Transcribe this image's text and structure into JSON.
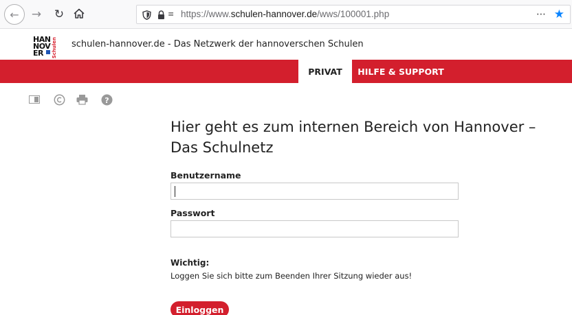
{
  "browser": {
    "url_prefix": "https://www.",
    "url_domain": "schulen-hannover.de",
    "url_path": "/wws/100001.php",
    "more_label": "⋯",
    "icons": [
      "back-arrow-icon",
      "forward-arrow-icon",
      "reload-icon",
      "home-icon",
      "shield-icon",
      "lock-icon",
      "permissions-icon",
      "more-icon",
      "star-icon"
    ],
    "accent_color": "#0a84ff"
  },
  "site": {
    "logo_lines": [
      "HAN",
      "NOV",
      "ER"
    ],
    "logo_sub": "Schulen",
    "tagline": "schulen-hannover.de - Das Netzwerk der hannoverschen Schulen",
    "brand_color": "#d31f2d"
  },
  "nav": {
    "tabs": [
      {
        "label": "PRIVAT",
        "active": true
      },
      {
        "label": "HILFE & SUPPORT",
        "active": false
      }
    ]
  },
  "tools": {
    "icons": [
      "window-icon",
      "copyright-icon",
      "print-icon",
      "help-icon"
    ]
  },
  "login": {
    "heading_line1": "Hier geht es zum internen Bereich von Hannover –",
    "heading_line2": "Das Schulnetz",
    "username_label": "Benutzername",
    "username_value": "",
    "password_label": "Passwort",
    "password_value": "",
    "note_title": "Wichtig:",
    "note_text": "Loggen Sie sich bitte zum Beenden Ihrer Sitzung wieder aus!",
    "submit_label": "Einloggen"
  }
}
